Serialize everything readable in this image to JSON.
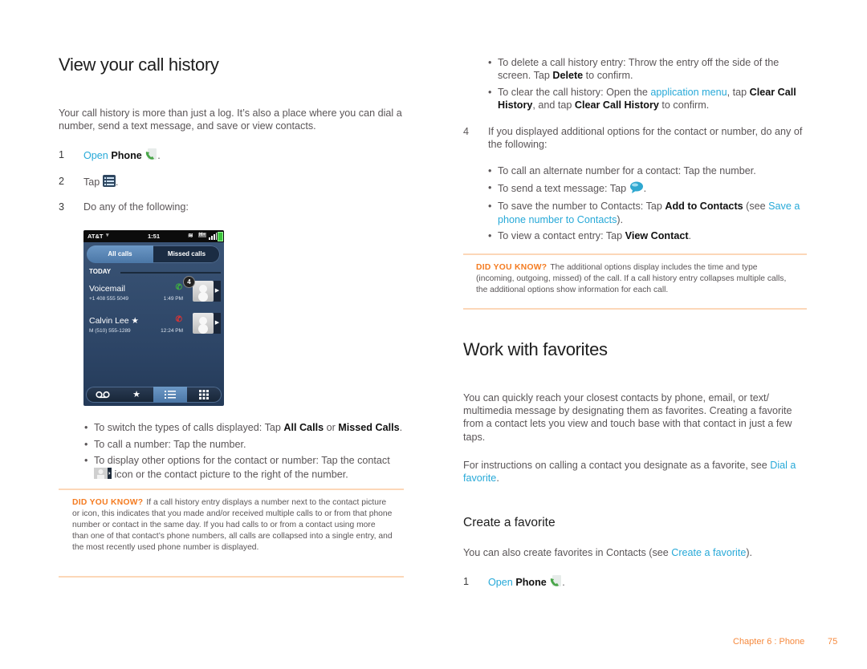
{
  "left": {
    "title": "View your call history",
    "intro": "Your call history is more than just a log. It’s also a place where you can dial a number, send a text message, and save or view contacts.",
    "steps": [
      {
        "num": "1",
        "link": "Open",
        "bold": "Phone",
        "icon": "phone-app-icon",
        "end": "."
      },
      {
        "num": "2",
        "text": "Tap",
        "icon": "call-log-icon",
        "end": "."
      },
      {
        "num": "3",
        "text": "Do any of the following:"
      }
    ],
    "phone_screen": {
      "carrier": "AT&T",
      "time": "1:51",
      "tabs": [
        "All calls",
        "Missed calls"
      ],
      "section": "TODAY",
      "entries": [
        {
          "name": "Voicemail",
          "number": "+1 408 555 5049",
          "time": "1:49 PM",
          "type": "incoming",
          "badge": "4"
        },
        {
          "name": "Calvin Lee ★",
          "number": "M (510) 555-1289",
          "time": "12:24 PM",
          "type": "missed"
        }
      ],
      "bottom_buttons": [
        "voicemail",
        "favorites",
        "call-log",
        "dialpad"
      ]
    },
    "bullets": [
      {
        "pre": "To switch the types of calls displayed: Tap ",
        "b1": "All Calls",
        "mid": " or ",
        "b2": "Missed Calls",
        "post": "."
      },
      {
        "pre": "To call a number: Tap the number."
      },
      {
        "pre": "To display other options for the contact or number: Tap the contact ",
        "icon": "contact-icon",
        "post": " icon or the contact picture to the right of the number."
      }
    ],
    "did_you_know": {
      "label": "DID YOU KNOW?",
      "text": "If a call history entry displays a number next to the contact picture or icon, this indicates that you made and/or received multiple calls to or from that phone number or contact in the same day. If you had calls to or from a contact using more than one of that contact’s phone numbers, all calls are collapsed into a single entry, and the most recently used phone number is displayed."
    }
  },
  "right": {
    "bullets_top": [
      {
        "pre": "To delete a call history entry: Throw the entry off the side of the screen. Tap ",
        "b1": "Delete",
        "post": " to confirm."
      },
      {
        "pre": "To clear the call history: Open the ",
        "link": "application menu",
        "mid": ", tap ",
        "b1": "Clear Call History",
        "mid2": ", and tap ",
        "b2": "Clear Call History",
        "post": " to confirm."
      }
    ],
    "step4": {
      "num": "4",
      "text": "If you displayed additional options for the contact or number, do any of the following:"
    },
    "bullets_step4": [
      {
        "pre": "To call an alternate number for a contact: Tap the number."
      },
      {
        "pre": "To send a text message: Tap ",
        "icon": "message-icon",
        "post": "."
      },
      {
        "pre": "To save the number to Contacts: Tap ",
        "b1": "Add to Contacts",
        "mid": " (see ",
        "link": "Save a phone number to Contacts",
        "post": ")."
      },
      {
        "pre": "To view a contact entry: Tap ",
        "b1": "View Contact",
        "post": "."
      }
    ],
    "did_you_know": {
      "label": "DID YOU KNOW?",
      "text": "The additional options display includes the time and type (incoming, outgoing, missed) of the call. If a call history entry collapses multiple calls, the additional options show information for each call."
    },
    "title": "Work with favorites",
    "intro": "You can quickly reach your closest contacts by phone, email, or text/ multimedia message by designating them as favorites. Creating a favorite from a contact lets you view and touch base with that contact in just a few taps.",
    "instructions": {
      "pre": "For instructions on calling a contact you designate as a favorite, see ",
      "link": "Dial a favorite",
      "post": "."
    },
    "subtitle": "Create a favorite",
    "sub_intro": {
      "pre": "You can also create favorites in Contacts (see ",
      "link": "Create a favorite",
      "post": ")."
    },
    "steps": [
      {
        "num": "1",
        "link": "Open",
        "bold": "Phone",
        "icon": "phone-app-icon",
        "end": "."
      }
    ]
  },
  "footer": {
    "chapter": "Chapter 6  :  Phone",
    "page": "75"
  },
  "colors": {
    "link": "#27a9d8",
    "accent": "#f47b20",
    "rule": "#fcd7b8",
    "body_text": "#5a5557"
  }
}
